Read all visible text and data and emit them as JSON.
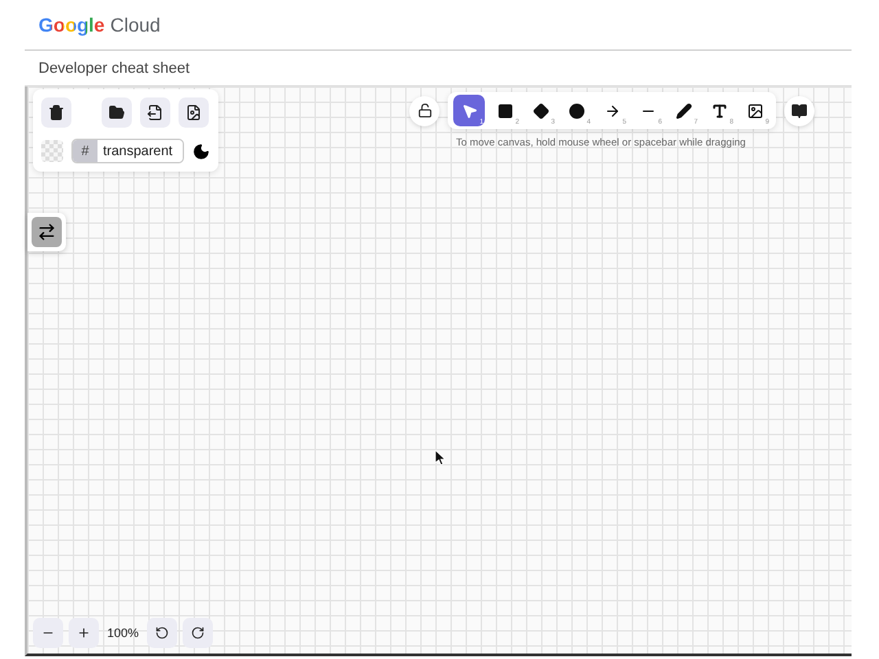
{
  "header": {
    "logo": "Google",
    "product": "Cloud"
  },
  "page_title": "Developer cheat sheet",
  "background_field": {
    "prefix": "#",
    "value": "transparent"
  },
  "tools": [
    {
      "kind": "select",
      "shortcut": "1",
      "selected": true
    },
    {
      "kind": "rectangle",
      "shortcut": "2",
      "selected": false
    },
    {
      "kind": "diamond",
      "shortcut": "3",
      "selected": false
    },
    {
      "kind": "ellipse",
      "shortcut": "4",
      "selected": false
    },
    {
      "kind": "arrow",
      "shortcut": "5",
      "selected": false
    },
    {
      "kind": "line",
      "shortcut": "6",
      "selected": false
    },
    {
      "kind": "draw",
      "shortcut": "7",
      "selected": false
    },
    {
      "kind": "text",
      "shortcut": "8",
      "selected": false
    },
    {
      "kind": "image",
      "shortcut": "9",
      "selected": false
    }
  ],
  "hint": "To move canvas, hold mouse wheel or spacebar while dragging",
  "zoom": "100%"
}
